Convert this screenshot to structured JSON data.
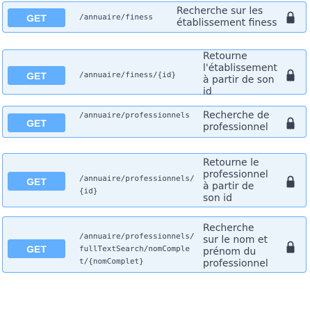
{
  "operations": [
    {
      "method": "GET",
      "path": "/annuaire/finess",
      "description_lines": [
        "Recherche sur les",
        "établissement finess"
      ]
    },
    {
      "method": "GET",
      "path": "/annuaire/finess/{id}",
      "description_lines": [
        "Retourne",
        "l'établissement",
        "à partir de son",
        "id"
      ]
    },
    {
      "method": "GET",
      "path": "/annuaire/professionnels",
      "description_lines": [
        "Recherche de",
        "professionnel"
      ]
    },
    {
      "method": "GET",
      "path": "/annuaire/professionnels/{id}",
      "description_lines": [
        "Retourne le",
        "professionnel",
        "à partir de",
        "son id"
      ]
    },
    {
      "method": "GET",
      "path": "/annuaire/professionnels/fullTextSearch/nomComplet/{nomComplet}",
      "description_lines": [
        "Recherche",
        "sur le nom et",
        "prénom du",
        "professionnel"
      ]
    }
  ],
  "icons": {
    "lock": "lock-icon"
  },
  "colors": {
    "get_badge": "#61affe",
    "row_background": "#ebf3fb",
    "row_border": "#61affe",
    "text": "#3b4151"
  }
}
